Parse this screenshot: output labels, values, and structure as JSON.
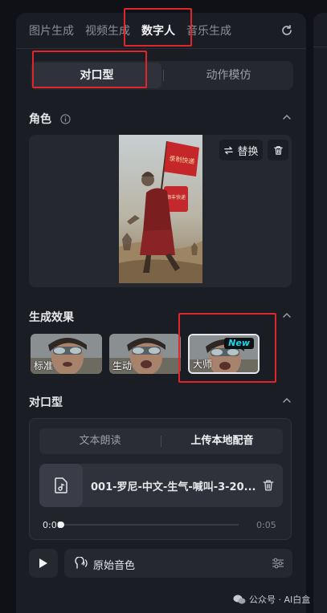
{
  "tabs": [
    "图片生成",
    "视频生成",
    "数字人",
    "音乐生成"
  ],
  "mode_segment": [
    "对口型",
    "动作模仿"
  ],
  "role": {
    "title": "角色",
    "replace_label": "替换",
    "flag_text": "录制快递",
    "box_text": "顺丰快递"
  },
  "effect": {
    "title": "生成效果",
    "options": [
      "标准",
      "生动",
      "大师"
    ],
    "new_badge": "New"
  },
  "lip": {
    "title": "对口型",
    "tabs": [
      "文本朗读",
      "上传本地配音"
    ],
    "file_name": "001-罗尼-中文-生气-喊叫-3-20...",
    "time_current": "0:00",
    "time_total": "0:05",
    "progress": 0
  },
  "voice": {
    "label": "原始音色"
  },
  "watermark": "公众号 · AI白盒"
}
